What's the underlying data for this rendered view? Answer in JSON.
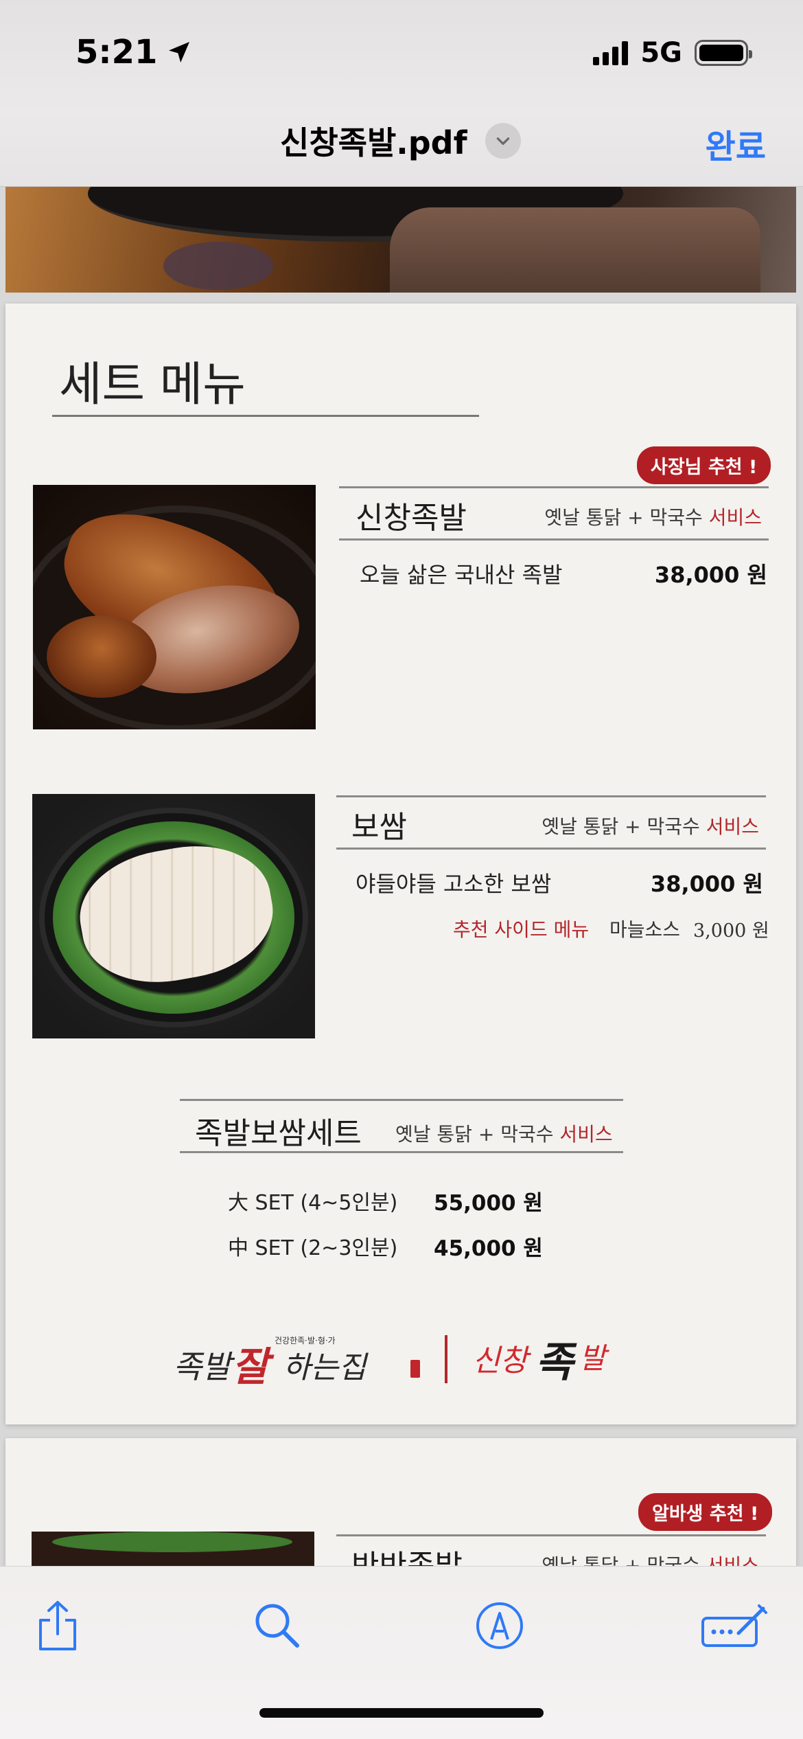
{
  "status_bar": {
    "time": "5:21",
    "network": "5G"
  },
  "nav": {
    "title": "신창족발.pdf",
    "done_label": "완료"
  },
  "page1": {
    "section_title": "세트 메뉴",
    "badge": "사장님 추천 !",
    "menus": [
      {
        "name": "신창족발",
        "extra_prefix": "옛날 통닭 + 막국수 ",
        "extra_service": "서비스",
        "description": "오늘 삶은 국내산 족발",
        "price": "38,000 원"
      },
      {
        "name": "보쌈",
        "extra_prefix": "옛날 통닭 + 막국수 ",
        "extra_service": "서비스",
        "description": "야들야들 고소한 보쌈",
        "price": "38,000 원",
        "side_label": "추천 사이드 메뉴",
        "side_item": "마늘소스",
        "side_price": "3,000 원"
      }
    ],
    "set": {
      "name": "족발보쌈세트",
      "extra_prefix": "옛날 통닭 + 막국수 ",
      "extra_service": "서비스",
      "options": [
        {
          "label": "大 SET (4~5인분)",
          "price": "55,000 원"
        },
        {
          "label": "中 SET (2~3인분)",
          "price": "45,000 원"
        }
      ]
    },
    "logos": {
      "left_text": "족발잘하는집",
      "left_tagline": "건강한족·발·형·가",
      "right_text": "신창족발"
    }
  },
  "page2": {
    "badge": "알바생 추천 !",
    "menu_name": "반반족발",
    "extra_prefix": "옛날 통닭 + 막국수 ",
    "extra_service": "서비스"
  },
  "toolbar": {
    "icons": [
      "share-icon",
      "search-icon",
      "markup-icon",
      "form-fill-icon"
    ]
  },
  "colors": {
    "accent_blue": "#2f7af6",
    "service_red": "#b3262b",
    "badge_red": "#b11f24",
    "page_bg": "#f3f2ef"
  }
}
